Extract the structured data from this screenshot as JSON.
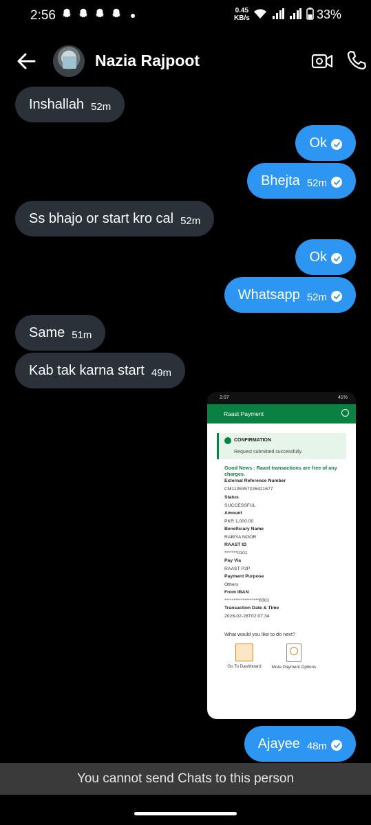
{
  "status_bar": {
    "time": "2:56",
    "net_speed": "0.45",
    "net_unit": "KB/s",
    "battery": "33%"
  },
  "header": {
    "contact_name": "Nazia Rajpoot"
  },
  "messages": [
    {
      "dir": "in",
      "text": "Inshallah",
      "time": "52m"
    },
    {
      "dir": "out",
      "text": "Ok",
      "time": ""
    },
    {
      "dir": "out",
      "text": "Bhejta",
      "time": "52m"
    },
    {
      "dir": "in",
      "text": "Ss bhajo or start kro cal",
      "time": "52m"
    },
    {
      "dir": "out",
      "text": "Ok",
      "time": ""
    },
    {
      "dir": "out",
      "text": "Whatsapp",
      "time": "52m"
    },
    {
      "dir": "in",
      "text": "Same",
      "time": "51m"
    },
    {
      "dir": "in",
      "text": "Kab tak karna start",
      "time": "49m"
    },
    {
      "dir": "out",
      "text": "Ajayee",
      "time": "48m"
    }
  ],
  "shared_image": {
    "status_time": "2:07",
    "status_battery": "41%",
    "title": "Raast Payment",
    "confirm_heading": "CONFIRMATION",
    "confirm_sub": "Request submitted successfully.",
    "good_news": "Good News : Raast transactions are free of any charges.",
    "fields": [
      {
        "label": "External Reference Number",
        "value": "CM1105357226421677"
      },
      {
        "label": "Status",
        "value": "SUCCESSFUL"
      },
      {
        "label": "Amount",
        "value": "PKR 1,000.00"
      },
      {
        "label": "Beneficiary Name",
        "value": "RABIYA NOOR"
      },
      {
        "label": "RAAST ID",
        "value": "*******0101"
      },
      {
        "label": "Pay Via",
        "value": "RAAST P2P"
      },
      {
        "label": "Payment Purpose",
        "value": "Others"
      },
      {
        "label": "From IBAN",
        "value": "*******************8301"
      },
      {
        "label": "Transaction Date & Time",
        "value": "2026-02-28T02:07:34"
      }
    ],
    "next_question": "What would you like to do next?",
    "option_dashboard": "Go To Dashboard",
    "option_more": "More Payment Options"
  },
  "footer": {
    "blocked_text": "You cannot send Chats to this person"
  }
}
